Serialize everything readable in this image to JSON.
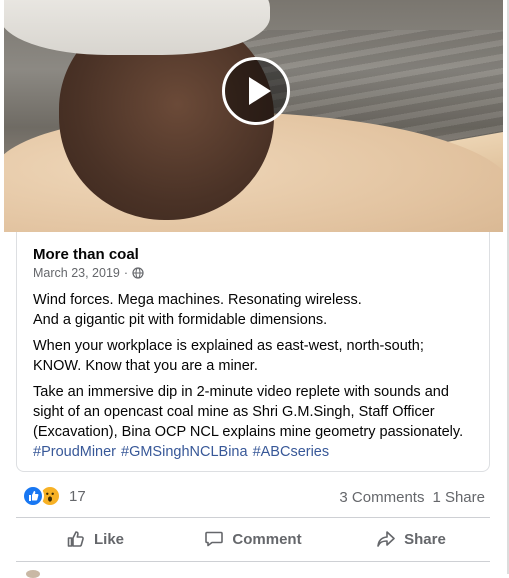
{
  "post": {
    "title": "More than coal",
    "date": "March 23, 2019",
    "separator": "·",
    "privacy_icon": "globe-icon",
    "paragraph1_line1": "Wind forces. Mega machines. Resonating wireless.",
    "paragraph1_line2": "And a gigantic pit with formidable dimensions.",
    "paragraph2_line1": "When your workplace is explained as east-west, north-south;",
    "paragraph2_line2": "KNOW.  Know that you are a miner.",
    "paragraph3_line1": "Take an immersive dip in 2-minute video replete with sounds and",
    "paragraph3_line2": "sight of an opencast coal mine as Shri G.M.Singh, Staff Officer",
    "paragraph3_line3": "(Excavation), Bina OCP NCL explains mine geometry passionately.",
    "hashtags": [
      "#ProudMiner",
      "#GMSinghNCLBina",
      "#ABCseries"
    ]
  },
  "video": {
    "play_icon": "play-icon"
  },
  "stats": {
    "reaction_icons": [
      "like-reaction-icon",
      "wow-reaction-icon"
    ],
    "reaction_count": "17",
    "comments": "3 Comments",
    "shares": "1 Share"
  },
  "actions": {
    "like": "Like",
    "comment": "Comment",
    "share": "Share"
  },
  "colors": {
    "link": "#385898",
    "like_blue": "#1877f2",
    "wow_yellow": "#f7b125",
    "muted": "#65676b"
  }
}
